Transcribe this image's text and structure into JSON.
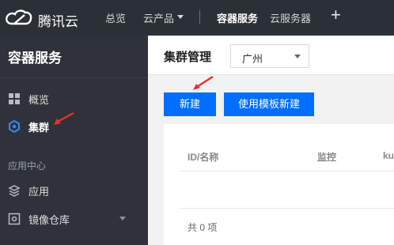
{
  "topbar": {
    "logo_text": "腾讯云",
    "nav": [
      {
        "label": "总览"
      },
      {
        "label": "云产品"
      },
      {
        "label": "容器服务"
      },
      {
        "label": "云服务器"
      }
    ],
    "plus": "+"
  },
  "sidebar": {
    "title": "容器服务",
    "items": [
      {
        "label": "概览",
        "icon": "grid-icon"
      },
      {
        "label": "集群",
        "icon": "hexagon-icon"
      }
    ],
    "group_label": "应用中心",
    "group_items": [
      {
        "label": "应用",
        "icon": "layers-icon"
      },
      {
        "label": "镜像仓库",
        "icon": "box-icon"
      }
    ]
  },
  "main": {
    "title": "集群管理",
    "region": {
      "value": "广州"
    },
    "buttons": {
      "new": "新建",
      "template": "使用模板新建"
    },
    "table": {
      "columns": [
        "ID/名称",
        "监控",
        "ku"
      ],
      "total": "共 0 项"
    }
  },
  "colors": {
    "topbar": "#2b2f36",
    "sidebar": "#2f323a",
    "accent": "#006eff",
    "active_icon": "#2d8cff",
    "annotation": "#e5322d"
  }
}
